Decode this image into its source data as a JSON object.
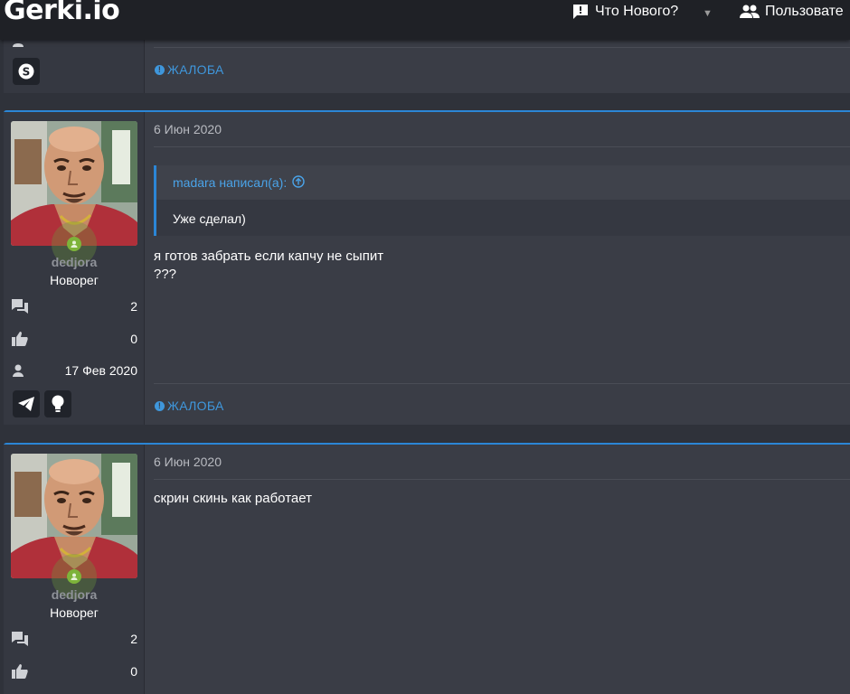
{
  "header": {
    "logo": "Gerki.io",
    "nav": [
      {
        "label": "Что Нового?",
        "icon": "message-alert-icon"
      },
      {
        "label": "Пользовате",
        "icon": "users-icon"
      }
    ]
  },
  "posts": [
    {
      "report_label": "ЖАЛОБА",
      "contacts": [
        "skype-icon"
      ]
    },
    {
      "date": "6 Июн 2020",
      "username": "dedjora",
      "user_title": "Новорег",
      "stats": {
        "messages": "2",
        "reactions": "0",
        "joined": "17 Фев 2020"
      },
      "quote": {
        "author": "madara написал(а):",
        "text": "Уже сделал)"
      },
      "message_lines": [
        "я готов забрать если капчу не сыпит",
        "???"
      ],
      "report_label": "ЖАЛОБА",
      "contacts": [
        "telegram-icon",
        "lightbulb-icon"
      ]
    },
    {
      "date": "6 Июн 2020",
      "username": "dedjora",
      "user_title": "Новорег",
      "stats": {
        "messages": "2",
        "reactions": "0"
      },
      "message_lines": [
        "скрин скинь как работает"
      ]
    }
  ],
  "colors": {
    "accent": "#2b86d6",
    "online": "#7db33a",
    "link": "#4aa3e8"
  }
}
